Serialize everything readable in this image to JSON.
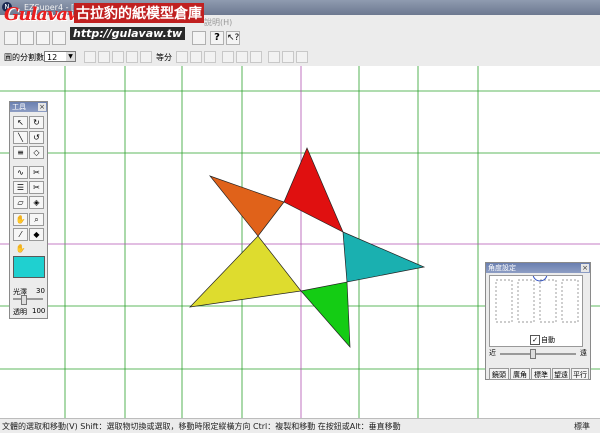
{
  "window": {
    "title": "EZSuper4 - [五芒星 - aaaagaaaa.EKT]"
  },
  "menu": {
    "help_label": "說明(H)"
  },
  "logo": {
    "brand": "Gulavaw",
    "name": "古拉豹的紙模型倉庫",
    "url": "http://gulavaw.tw"
  },
  "toolbar": {
    "divisions_label": "圓的分割數",
    "divisions_value": "12",
    "equal_label": "等分"
  },
  "tools_panel": {
    "title": "工具",
    "icons": [
      "select-arrow-icon",
      "rotate-icon",
      "line-icon",
      "arc-icon",
      "multi-line-icon",
      "polygon-icon",
      "node-icon",
      "scissors-icon",
      "align-icon",
      "cut-icon",
      "shape-icon",
      "cube-icon",
      "hand-icon",
      "zoom-icon",
      "eyedropper-icon",
      "fill-bucket-icon",
      "pan-hand-icon"
    ],
    "gloss_label": "光澤",
    "gloss_value": "30",
    "opacity_label": "透明",
    "opacity_value": "100",
    "color": "#1fd0d0"
  },
  "angle_panel": {
    "title": "角度設定",
    "checkbox_label": "自動",
    "near_label": "近",
    "far_label": "遠",
    "buttons": [
      "鏡頭",
      "廣角",
      "標準",
      "望遠",
      "平行"
    ]
  },
  "statusbar": {
    "message": "文體的選取和移動(V)   Shift：選取物切換或選取，移動時限定縱橫方向 Ctrl：複製和移動 在按鈕或Alt：垂直移動",
    "mode": "標準"
  },
  "star": {
    "pieces": [
      {
        "name": "orange",
        "color": "#e0621a"
      },
      {
        "name": "red",
        "color": "#e01010"
      },
      {
        "name": "teal",
        "color": "#1ab0b0"
      },
      {
        "name": "green",
        "color": "#14cc14"
      },
      {
        "name": "yellow",
        "color": "#dedc2e"
      }
    ]
  }
}
